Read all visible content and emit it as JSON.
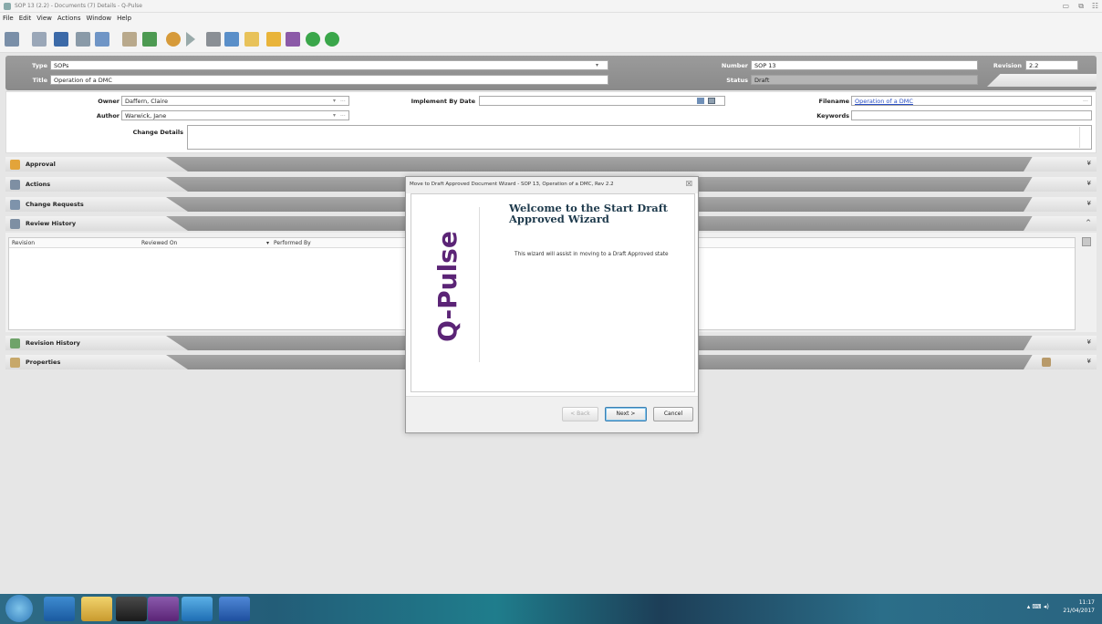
{
  "window": {
    "title": "SOP 13 (2.2) - Documents (7) Details - Q-Pulse",
    "controls": [
      "▭",
      "⧉",
      "☷"
    ]
  },
  "menu": [
    "File",
    "Edit",
    "View",
    "Actions",
    "Window",
    "Help"
  ],
  "header": {
    "type_label": "Type",
    "type_value": "SOPs",
    "title_label": "Title",
    "title_value": "Operation of a DMC",
    "number_label": "Number",
    "number_value": "SOP 13",
    "revision_label": "Revision",
    "revision_value": "2.2",
    "status_label": "Status",
    "status_value": "Draft"
  },
  "details": {
    "owner_label": "Owner",
    "owner_value": "Daffern, Claire",
    "author_label": "Author",
    "author_value": "Warwick, Jane",
    "implement_label": "Implement By Date",
    "implement_value": "",
    "filename_label": "Filename",
    "filename_value": "Operation of a DMC",
    "keywords_label": "Keywords",
    "keywords_value": "",
    "change_label": "Change Details",
    "change_value": "",
    "ellipsis": "...",
    "dropdown": "▾"
  },
  "sections": {
    "approval": "Approval",
    "actions": "Actions",
    "change_requests": "Change Requests",
    "review_history": "Review History",
    "revision_history": "Revision History",
    "properties": "Properties",
    "collapsed_chevron": "¥",
    "expanded_chevron": "^"
  },
  "review_grid": {
    "columns": [
      "Revision",
      "Reviewed On",
      "Performed By"
    ],
    "sort_indicator": "▾"
  },
  "dialog": {
    "title": "Move to Draft Approved Document Wizard - SOP 13, Operation of a DMC, Rev 2.2",
    "close": "☒",
    "logo": "Q-Pulse",
    "heading": "Welcome to the Start Draft Approved Wizard",
    "body": "This wizard will assist in moving to a Draft Approved state",
    "back": "< Back",
    "next": "Next >",
    "cancel": "Cancel"
  },
  "taskbar": {
    "time": "11:17",
    "date": "21/04/2017",
    "tray_icons": "▴ ⌨ ◂)"
  },
  "colors": {
    "qpulse_purple": "#5b2476",
    "header_gray": "#8f8f8f",
    "link_blue": "#2a4fc4"
  }
}
